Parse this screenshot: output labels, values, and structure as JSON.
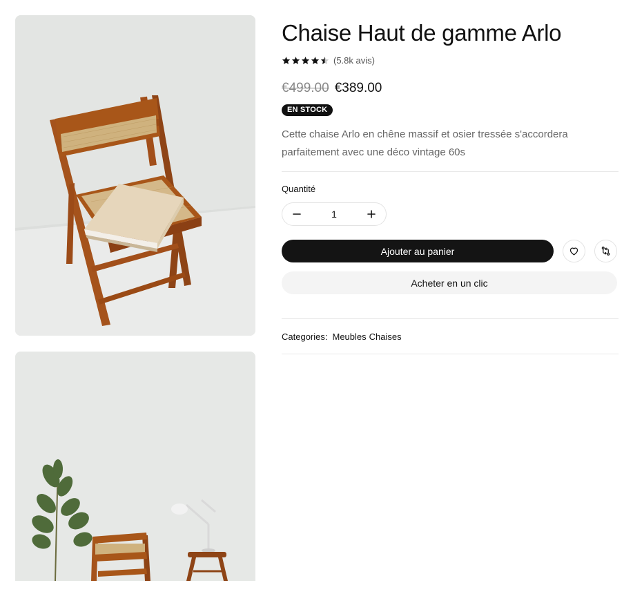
{
  "product": {
    "title": "Chaise Haut de gamme Arlo",
    "rating": 4.5,
    "rating_max": 5,
    "reviews": "(5.8k avis)",
    "old_price": "€499.00",
    "new_price": "€389.00",
    "stock_badge": "EN STOCK",
    "description": "Cette chaise Arlo en chêne massif et osier tressée s'accordera parfaitement avec une déco vintage 60s"
  },
  "quantity": {
    "label": "Quantité",
    "value": "1"
  },
  "actions": {
    "add_to_cart": "Ajouter au panier",
    "buy_now": "Acheter en un clic"
  },
  "categories": {
    "label": "Categories:",
    "items": [
      "Meubles",
      "Chaises"
    ]
  },
  "icons": {
    "wishlist": "heart-icon",
    "compare": "compare-icon",
    "decrease": "minus-icon",
    "increase": "plus-icon"
  },
  "colors": {
    "primary_button": "#141414",
    "secondary_button": "#f4f4f4",
    "wood": "#9a4f1c",
    "rattan": "#d2b58a"
  }
}
